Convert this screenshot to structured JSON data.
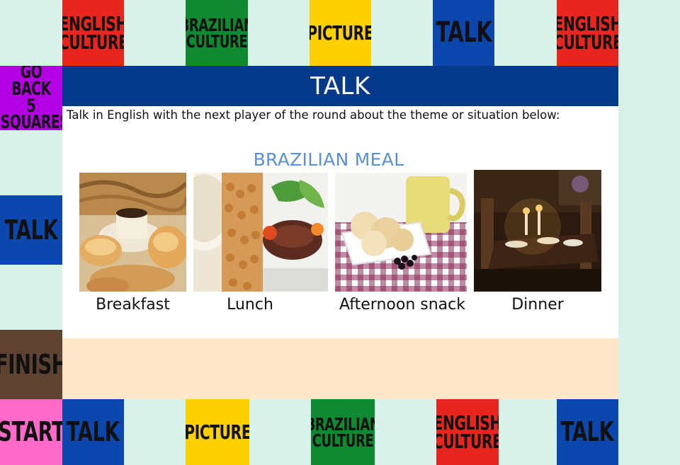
{
  "board": {
    "top_row": [
      {
        "label": "ENGLISH CULTURE",
        "line1": "ENGLISH",
        "line2": "CULTURE",
        "color": "#e8251f"
      },
      {
        "label": "BRAZILIAN CULTURE",
        "line1": "BRAZILIAN",
        "line2": "CULTURE",
        "color": "#0f8a33"
      },
      {
        "label": "PICTURE",
        "line1": "PICTURE",
        "color": "#fdd000"
      },
      {
        "label": "TALK",
        "line1": "TALK",
        "color": "#0b47ad"
      },
      {
        "label": "ENGLISH CULTURE",
        "line1": "ENGLISH",
        "line2": "CULTURE",
        "color": "#e8251f"
      }
    ],
    "left_column": [
      {
        "label": "GO BACK 5 SQUARES",
        "line1": "GO BACK",
        "line2": "5 SQUARES",
        "color": "#b200e3"
      },
      {
        "label": "TALK",
        "line1": "TALK",
        "color": "#0b47ad"
      },
      {
        "label": "FINISH",
        "line1": "FINISH",
        "color": "#5e4232"
      }
    ],
    "bottom_row": [
      {
        "label": "START",
        "line1": "START",
        "color": "#ff6ac9"
      },
      {
        "label": "TALK",
        "line1": "TALK",
        "color": "#0b47ad"
      },
      {
        "label": "PICTURE",
        "line1": "PICTURE",
        "color": "#fdd000"
      },
      {
        "label": "BRAZILIAN CULTURE",
        "line1": "BRAZILIAN",
        "line2": "CULTURE",
        "color": "#0f8a33"
      },
      {
        "label": "ENGLISH CULTURE",
        "line1": "ENGLISH",
        "line2": "CULTURE",
        "color": "#e8251f"
      },
      {
        "label": "TALK",
        "line1": "TALK",
        "color": "#0b47ad"
      }
    ]
  },
  "card": {
    "title": "TALK",
    "instruction": "Talk in English with the next player of the round about the theme or situation below:",
    "theme": "BRAZILIAN MEAL",
    "meals": [
      {
        "caption": "Breakfast",
        "icon": "breakfast-photo"
      },
      {
        "caption": "Lunch",
        "icon": "lunch-photo"
      },
      {
        "caption": "Afternoon snack",
        "icon": "afternoon-snack-photo"
      },
      {
        "caption": "Dinner",
        "icon": "dinner-photo"
      }
    ]
  },
  "colors": {
    "background": "#d8f2ea",
    "card_header": "#053a8a",
    "theme_text": "#5b8fd0",
    "finish_lane": "#ffe7c8"
  }
}
